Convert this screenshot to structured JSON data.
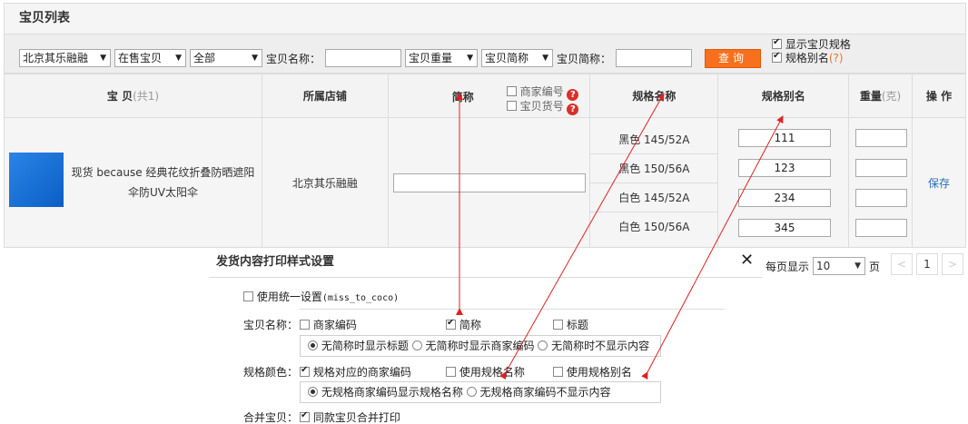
{
  "panel": {
    "title": "宝贝列表"
  },
  "filters": {
    "shop_select": "北京其乐融融",
    "status_select": "在售宝贝",
    "scope_select": "全部",
    "name_label": "宝贝名称：",
    "name_value": "",
    "weight_select": "宝贝重量",
    "shortname_select": "宝贝简称",
    "shortname_label": "宝贝简称：",
    "shortname_value": "",
    "search_button": "查询",
    "show_spec_label": "显示宝贝规格",
    "spec_alias_label": "规格别名",
    "spec_alias_mark": "(?)"
  },
  "table": {
    "headers": {
      "product": "宝 贝",
      "product_count": "(共1)",
      "shop": "所属店铺",
      "shortname": "简称",
      "merchant_code": "商家编号",
      "item_code": "宝贝货号",
      "spec_name": "规格名称",
      "spec_alias": "规格别名",
      "weight": "重量",
      "weight_unit": "(克)",
      "action": "操 作"
    },
    "row": {
      "product_name": "现货 because 经典花纹折叠防晒遮阳伞防UV太阳伞",
      "shop": "北京其乐融融",
      "shortname_value": "",
      "specs": [
        {
          "name": "黑色 145/52A",
          "alias": "111",
          "weight": ""
        },
        {
          "name": "黑色 150/56A",
          "alias": "123",
          "weight": ""
        },
        {
          "name": "白色 145/52A",
          "alias": "234",
          "weight": ""
        },
        {
          "name": "白色 150/56A",
          "alias": "345",
          "weight": ""
        }
      ],
      "action": "保存"
    }
  },
  "dialog": {
    "title": "发货内容打印样式设置",
    "close": "✕",
    "unified_label": "使用统一设置",
    "unified_user": "(miss_to_coco)",
    "name_row_label": "宝贝名称：",
    "name_opts": [
      "商家编码",
      "简称",
      "标题"
    ],
    "name_radios": [
      "无简称时显示标题",
      "无简称时显示商家编码",
      "无简称时不显示内容"
    ],
    "color_row_label": "规格颜色：",
    "color_opts": [
      "规格对应的商家编码",
      "使用规格名称",
      "使用规格别名"
    ],
    "color_radios": [
      "无规格商家编码显示规格名称",
      "无规格商家编码不显示内容"
    ],
    "merge_row_label": "合并宝贝：",
    "merge_opt": "同款宝贝合并打印"
  },
  "pager": {
    "per_page_label": "每页显示",
    "per_page_value": "10",
    "page_unit": "页",
    "prev": "<",
    "current": "1",
    "next": ">"
  },
  "colors": {
    "accent": "#f86f1d",
    "arrow": "#e02020"
  }
}
